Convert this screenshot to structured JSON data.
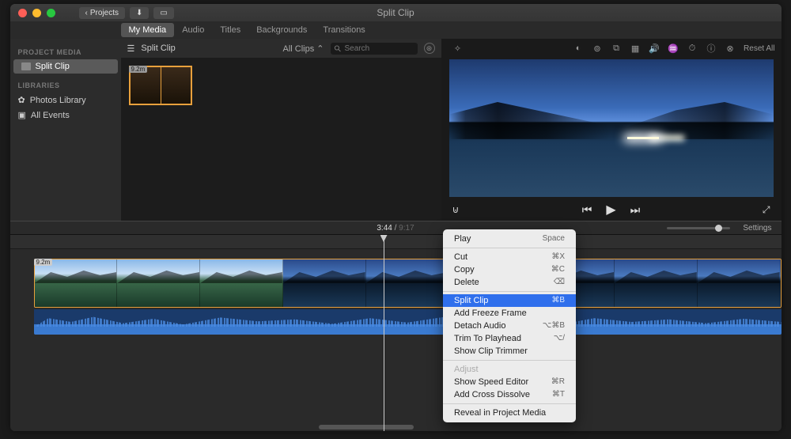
{
  "title": "Split Clip",
  "titlebar": {
    "back": "Projects"
  },
  "tabs": [
    "My Media",
    "Audio",
    "Titles",
    "Backgrounds",
    "Transitions"
  ],
  "active_tab": 0,
  "sidebar": {
    "section1": "PROJECT MEDIA",
    "item1": "Split Clip",
    "section2": "LIBRARIES",
    "item2": "Photos Library",
    "item3": "All Events"
  },
  "browser": {
    "title": "Split Clip",
    "filter": "All Clips",
    "search_placeholder": "Search",
    "clip_duration": "9.2m"
  },
  "viewer": {
    "reset": "Reset All",
    "tool_icons": [
      "wand-icon",
      "color-balance-icon",
      "color-correct-icon",
      "crop-icon",
      "stabilize-icon",
      "volume-icon",
      "noise-icon",
      "speed-icon",
      "info-icon",
      "filter-icon"
    ]
  },
  "time": {
    "current": "3:44",
    "total": "9:17",
    "settings": "Settings"
  },
  "strip_duration": "9.2m",
  "context_menu": {
    "items": [
      {
        "label": "Play",
        "shortcut": "Space"
      },
      {
        "sep": true
      },
      {
        "label": "Cut",
        "shortcut": "⌘X"
      },
      {
        "label": "Copy",
        "shortcut": "⌘C"
      },
      {
        "label": "Delete",
        "shortcut": "⌫"
      },
      {
        "sep": true
      },
      {
        "label": "Split Clip",
        "shortcut": "⌘B",
        "highlight": true
      },
      {
        "label": "Add Freeze Frame"
      },
      {
        "label": "Detach Audio",
        "shortcut": "⌥⌘B"
      },
      {
        "label": "Trim To Playhead",
        "shortcut": "⌥/"
      },
      {
        "label": "Show Clip Trimmer"
      },
      {
        "sep": true
      },
      {
        "label": "Adjust",
        "disabled": true
      },
      {
        "label": "Show Speed Editor",
        "shortcut": "⌘R"
      },
      {
        "label": "Add Cross Dissolve",
        "shortcut": "⌘T"
      },
      {
        "sep": true
      },
      {
        "label": "Reveal in Project Media"
      }
    ]
  }
}
